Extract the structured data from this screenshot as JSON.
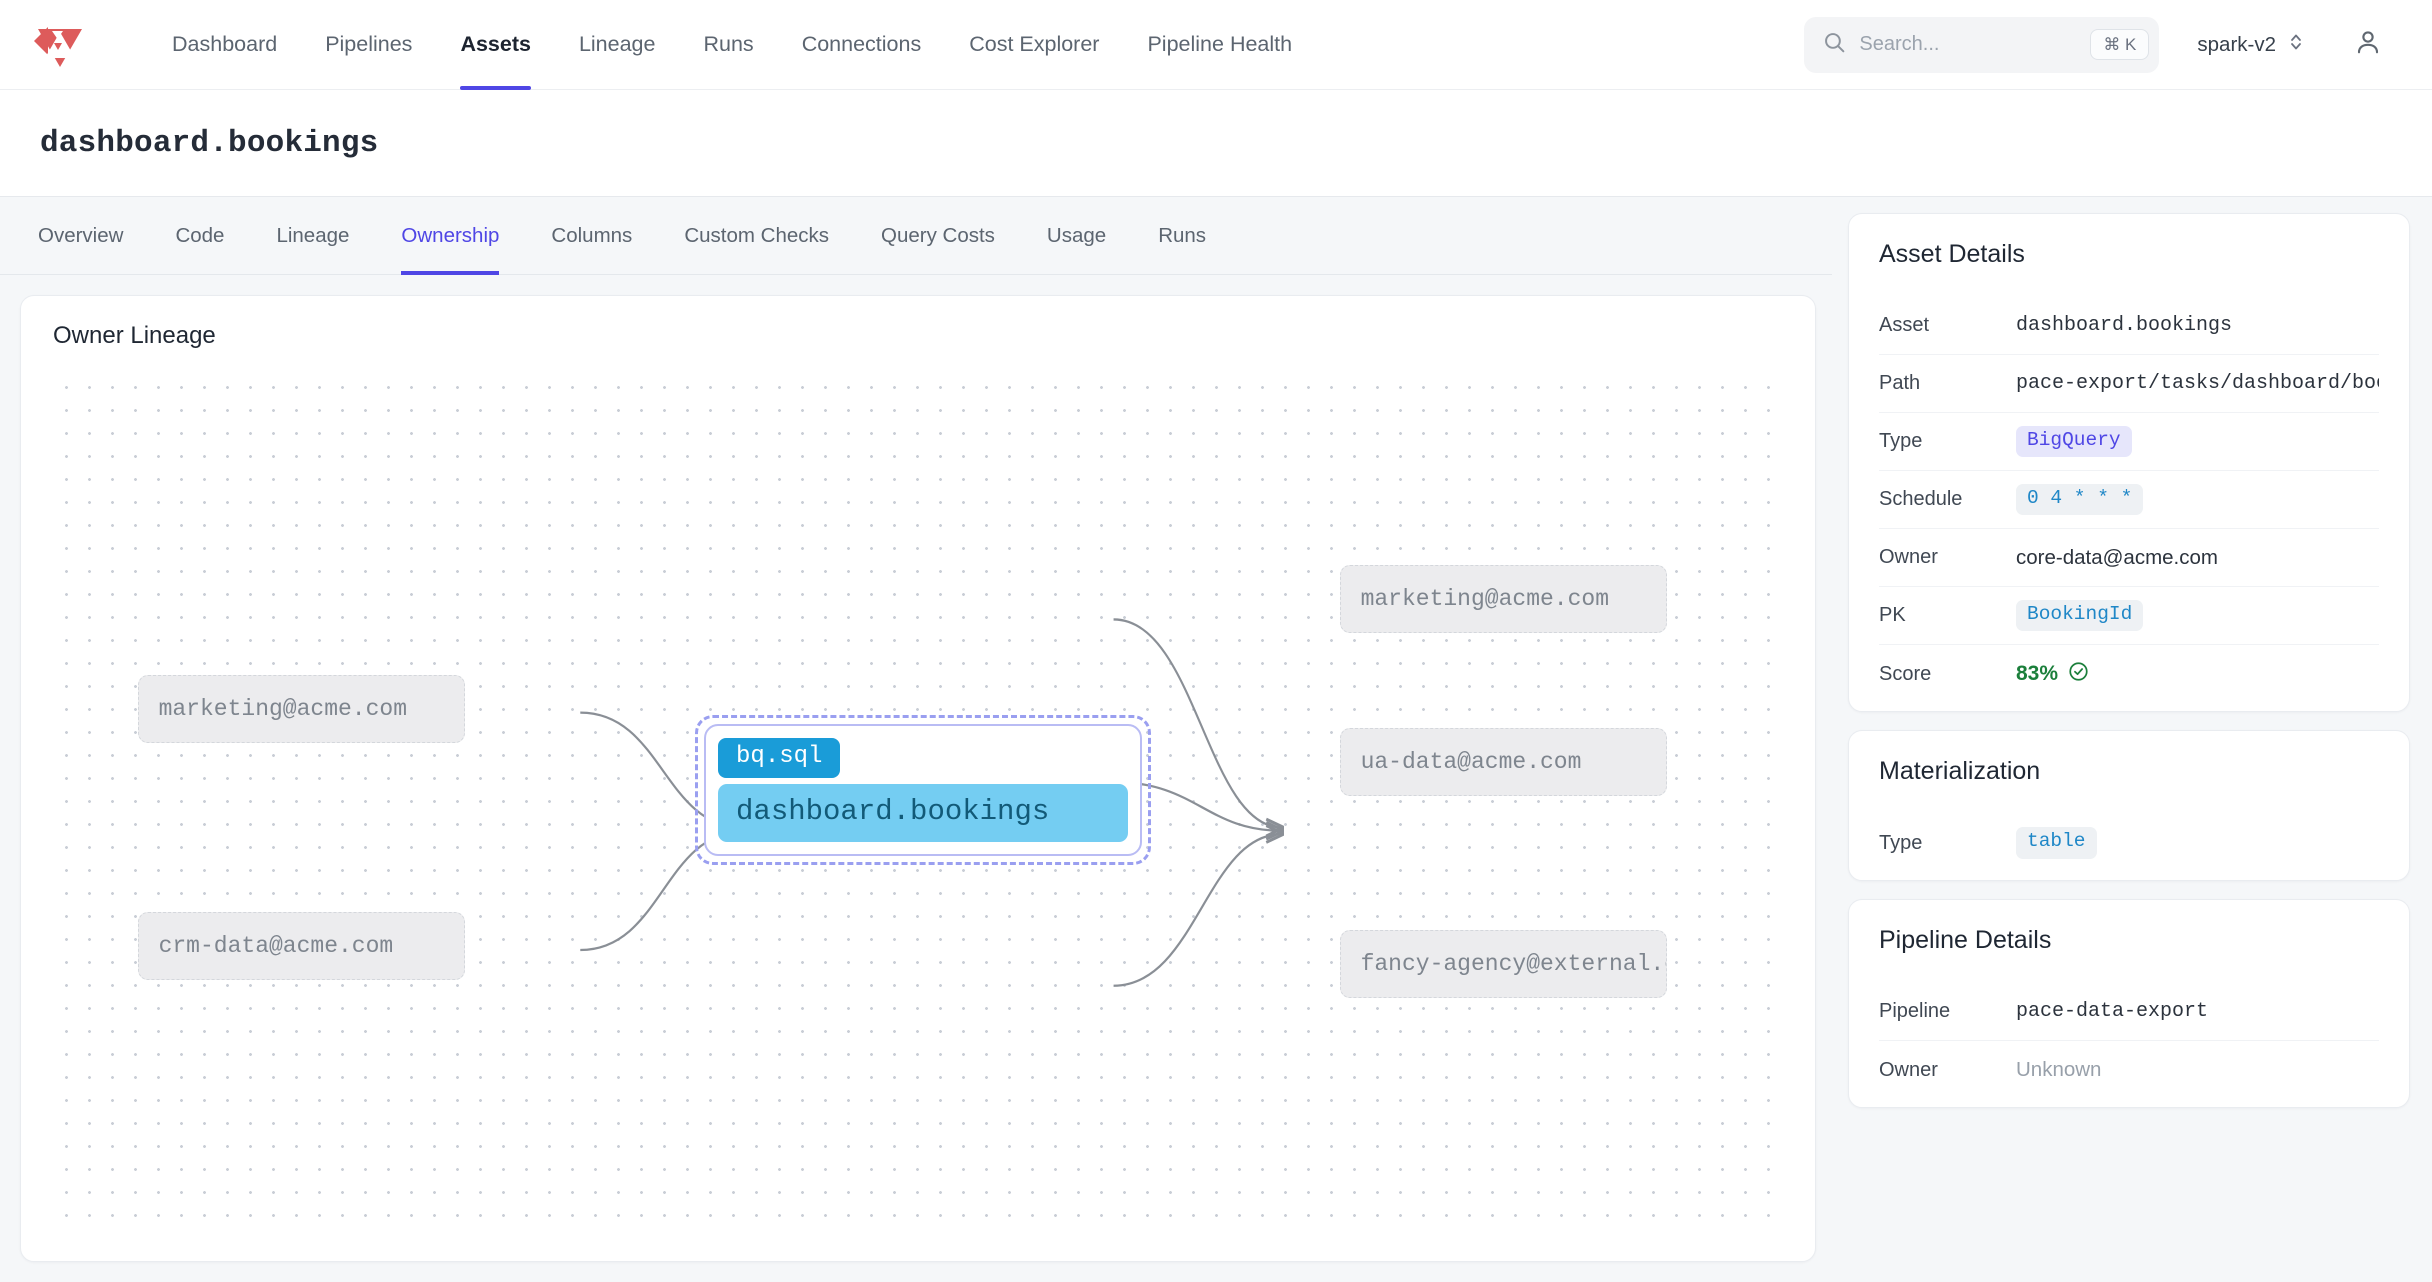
{
  "header": {
    "logo_icon": "triangle-shield-logo",
    "nav": [
      {
        "label": "Dashboard",
        "active": false
      },
      {
        "label": "Pipelines",
        "active": false
      },
      {
        "label": "Assets",
        "active": true
      },
      {
        "label": "Lineage",
        "active": false
      },
      {
        "label": "Runs",
        "active": false
      },
      {
        "label": "Connections",
        "active": false
      },
      {
        "label": "Cost Explorer",
        "active": false
      },
      {
        "label": "Pipeline Health",
        "active": false
      }
    ],
    "search": {
      "placeholder": "Search...",
      "shortcut": "⌘ K",
      "icon": "search-icon"
    },
    "project": {
      "name": "spark-v2",
      "icon": "chevron-up-down-icon"
    },
    "account": {
      "icon": "user-icon"
    }
  },
  "page": {
    "title": "dashboard.bookings"
  },
  "tabs": [
    {
      "label": "Overview",
      "active": false
    },
    {
      "label": "Code",
      "active": false
    },
    {
      "label": "Lineage",
      "active": false
    },
    {
      "label": "Ownership",
      "active": true
    },
    {
      "label": "Columns",
      "active": false
    },
    {
      "label": "Custom Checks",
      "active": false
    },
    {
      "label": "Query Costs",
      "active": false
    },
    {
      "label": "Usage",
      "active": false
    },
    {
      "label": "Runs",
      "active": false
    }
  ],
  "graph": {
    "title": "Owner Lineage",
    "center": {
      "badge": "bq.sql",
      "label": "dashboard.bookings"
    },
    "upstream": [
      {
        "label": "marketing@acme.com"
      },
      {
        "label": "crm-data@acme.com"
      }
    ],
    "downstream": [
      {
        "label": "marketing@acme.com"
      },
      {
        "label": "ua-data@acme.com"
      },
      {
        "label": "fancy-agency@external.c…"
      }
    ]
  },
  "asset_details": {
    "title": "Asset Details",
    "rows": [
      {
        "key": "Asset",
        "value": "dashboard.bookings",
        "style": "mono"
      },
      {
        "key": "Path",
        "value": "pace-export/tasks/dashboard/book:",
        "style": "mono"
      },
      {
        "key": "Type",
        "value": "BigQuery",
        "style": "chip-purple"
      },
      {
        "key": "Schedule",
        "value": "0 4 * * *",
        "style": "chip-blue"
      },
      {
        "key": "Owner",
        "value": "core-data@acme.com",
        "style": "plain"
      },
      {
        "key": "PK",
        "value": "BookingId",
        "style": "chip-blue"
      },
      {
        "key": "Score",
        "value": "83%",
        "style": "score",
        "icon": "check-circle-icon"
      }
    ]
  },
  "materialization": {
    "title": "Materialization",
    "rows": [
      {
        "key": "Type",
        "value": "table",
        "style": "chip-blue"
      }
    ]
  },
  "pipeline_details": {
    "title": "Pipeline Details",
    "rows": [
      {
        "key": "Pipeline",
        "value": "pace-data-export",
        "style": "mono"
      },
      {
        "key": "Owner",
        "value": "Unknown",
        "style": "muted"
      }
    ]
  },
  "colors": {
    "accent": "#4f46e5",
    "node_fill": "#ececee",
    "center_badge": "#1a9cd8",
    "center_body": "#74cdf2",
    "score_green": "#1b7f3b",
    "logo_red": "#dd5b5b"
  }
}
